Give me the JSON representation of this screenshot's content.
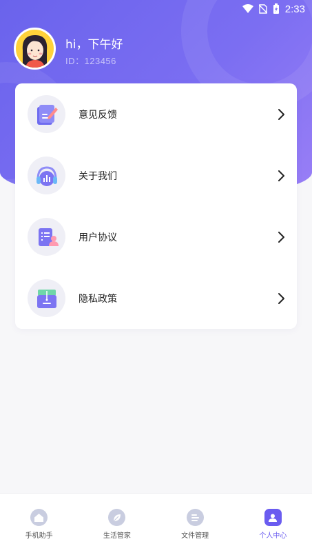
{
  "status_bar": {
    "time": "2:33"
  },
  "profile": {
    "greeting": "hi，下午好",
    "user_id": "ID：123456"
  },
  "menu": [
    {
      "label": "意见反馈",
      "icon": "feedback-icon"
    },
    {
      "label": "关于我们",
      "icon": "headphones-icon"
    },
    {
      "label": "用户协议",
      "icon": "user-agreement-icon"
    },
    {
      "label": "隐私政策",
      "icon": "privacy-box-icon"
    }
  ],
  "tabs": [
    {
      "label": "手机助手",
      "icon": "home-icon",
      "active": false
    },
    {
      "label": "生活管家",
      "icon": "leaf-icon",
      "active": false
    },
    {
      "label": "文件管理",
      "icon": "file-icon",
      "active": false
    },
    {
      "label": "个人中心",
      "icon": "person-icon",
      "active": true
    }
  ],
  "colors": {
    "accent": "#6a5cf0",
    "hero_start": "#6a63ec",
    "hero_end": "#9a7ff6"
  }
}
